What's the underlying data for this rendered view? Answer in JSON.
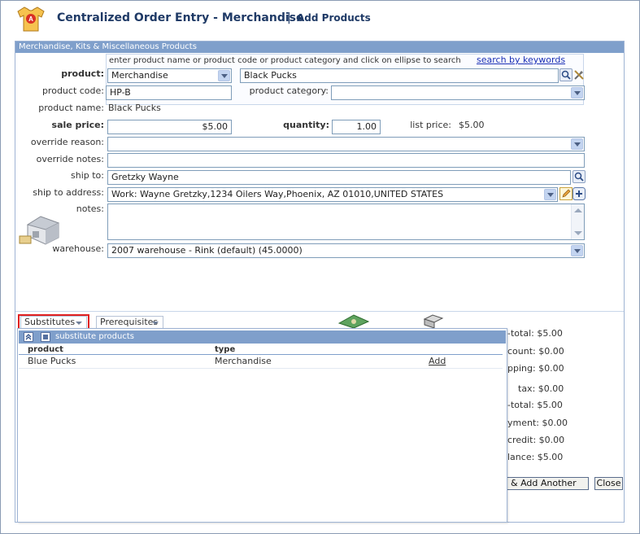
{
  "header": {
    "title": "Centralized Order Entry - Merchandise",
    "separator": "|",
    "subtitle": "Add Products"
  },
  "panel": {
    "title": "Merchandise, Kits & Miscellaneous Products"
  },
  "product_search": {
    "hint": "enter product name or product code or product category and click on ellipse to search",
    "keyword_link": "search by keywords",
    "product_label": "product:",
    "product_type": "Merchandise",
    "product_value": "Black Pucks",
    "code_label": "product code:",
    "code_value": "HP-B",
    "category_label": "product category:",
    "category_value": ""
  },
  "details": {
    "name_label": "product name:",
    "name_value": "Black Pucks",
    "sale_price_label": "sale price:",
    "sale_price_value": "$5.00",
    "quantity_label": "quantity:",
    "quantity_value": "1.00",
    "list_price_label": "list price:",
    "list_price_value": "$5.00",
    "override_reason_label": "override reason:",
    "override_reason_value": "",
    "override_notes_label": "override notes:",
    "override_notes_value": "",
    "ship_to_label": "ship to:",
    "ship_to_value": "Gretzky Wayne",
    "ship_address_label": "ship to address:",
    "ship_address_value": "Work: Wayne Gretzky,1234 Oilers Way,Phoenix, AZ 01010,UNITED STATES",
    "notes_label": "notes:",
    "notes_value": "",
    "warehouse_label": "warehouse:",
    "warehouse_value": "2007 warehouse - Rink (default) (45.0000)"
  },
  "tabs": {
    "substitutes": "Substitutes",
    "prerequisites": "Prerequisites"
  },
  "totals": [
    "-total:  $5.00",
    "count:  $0.00",
    "pping:  $0.00",
    "tax:  $0.00",
    "-total:  $5.00",
    "yment:  $0.00",
    "credit:  $0.00",
    "lance:  $5.00"
  ],
  "substitutes_popup": {
    "title": "substitute products",
    "col_product": "product",
    "col_type": "type",
    "rows": [
      {
        "product": "Blue Pucks",
        "type": "Merchandise",
        "action": "Add"
      }
    ]
  },
  "buttons": {
    "add_another": "& Add Another",
    "close": "Close"
  },
  "colors": {
    "title": "#1f3a66",
    "panel_header": "#7f9fcb",
    "link": "#1b2fb5",
    "highlight": "#e02020"
  }
}
